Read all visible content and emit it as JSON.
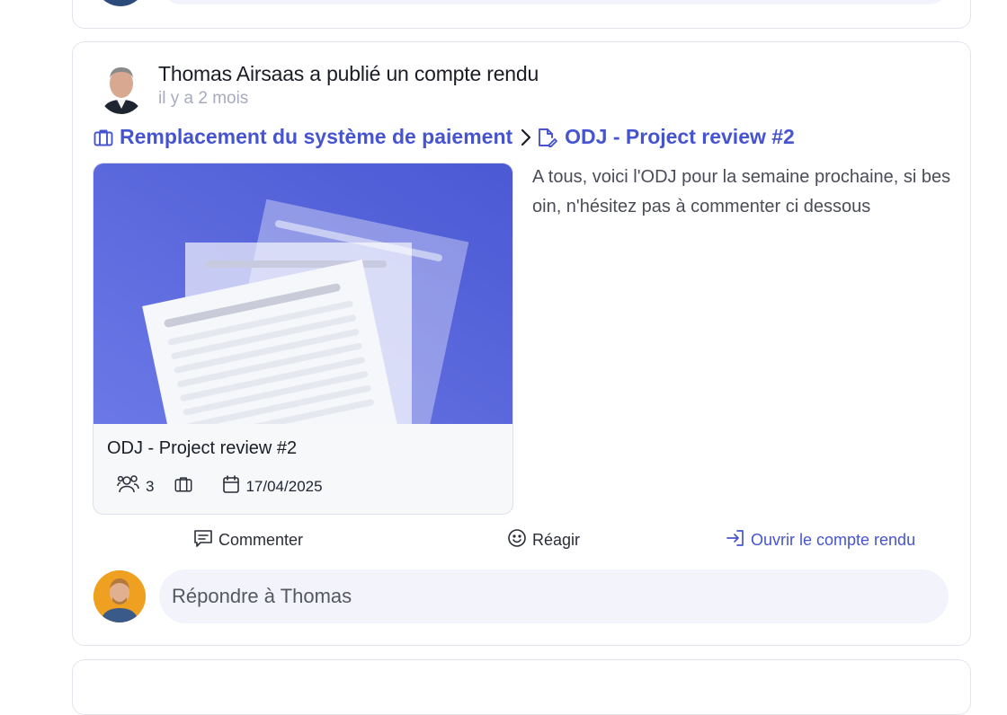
{
  "post": {
    "headline": "Thomas Airsaas a publié un compte rendu",
    "time_ago": "il y a 2 mois",
    "breadcrumb": {
      "project": "Remplacement du système de paiement",
      "report": "ODJ - Project review #2"
    },
    "body": "A tous, voici l'ODJ pour la semaine prochaine, si besoin, n'hésitez pas à commenter ci dessous",
    "preview": {
      "title": "ODJ - Project review #2",
      "participants": "3",
      "date": "17/04/2025"
    },
    "actions": {
      "comment": "Commenter",
      "react": "Réagir",
      "open": "Ouvrir le compte rendu"
    },
    "reply": {
      "placeholder": "Répondre à Thomas"
    }
  },
  "icons": {
    "briefcase": "briefcase-icon",
    "chevron": "chevron-right-icon",
    "document_edit": "document-edit-icon",
    "users": "users-icon",
    "calendar": "calendar-icon",
    "comment": "comment-icon",
    "smile": "smile-icon",
    "open": "open-arrow-icon"
  },
  "colors": {
    "accent": "#4654d0",
    "thumb_bg": "#5a68dc"
  }
}
